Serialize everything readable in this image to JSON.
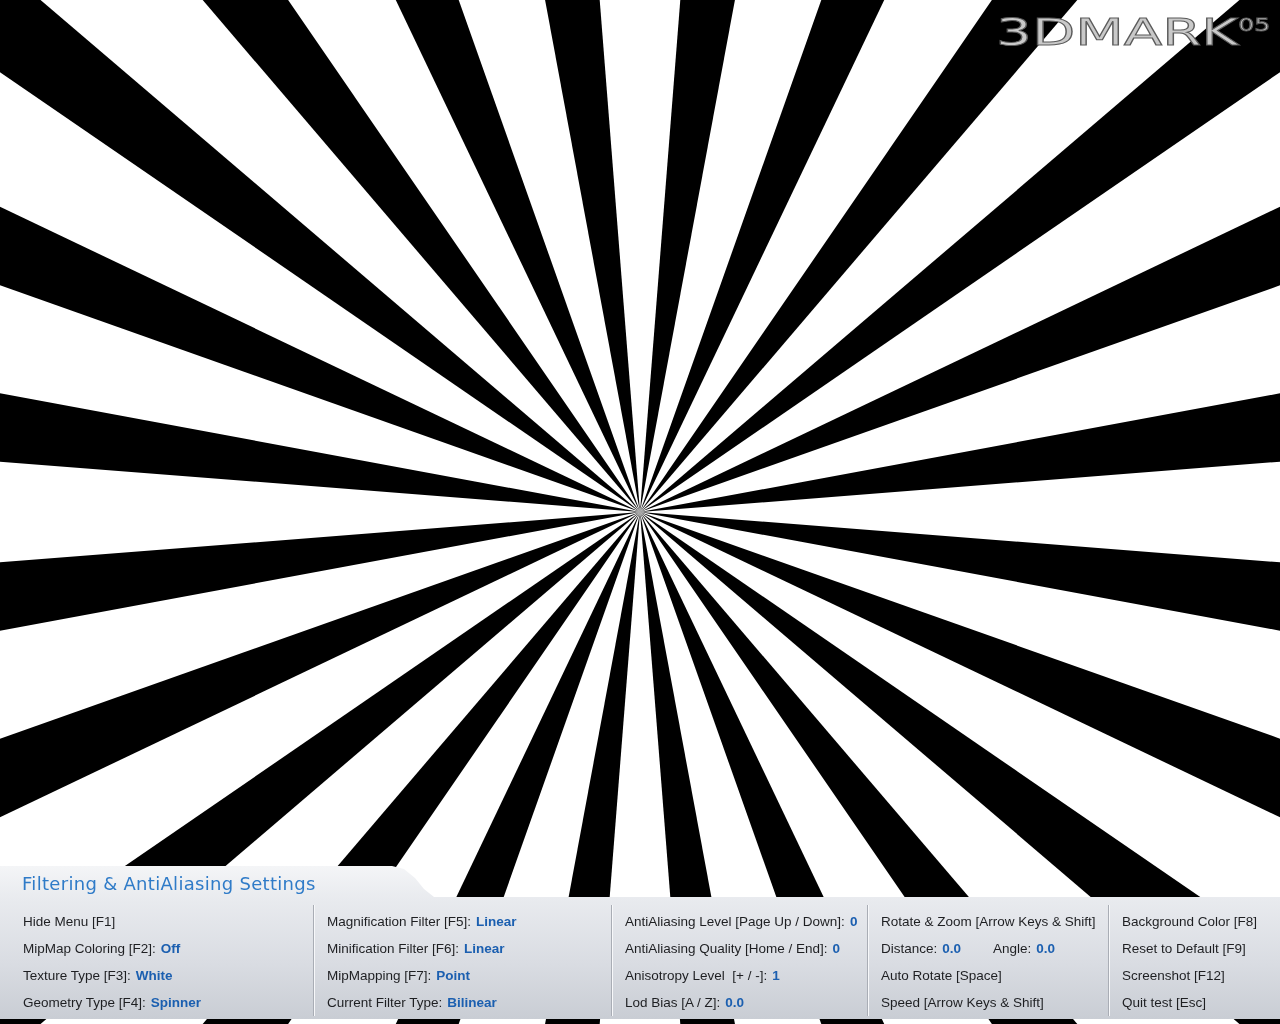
{
  "logo": {
    "name": "3DMARK",
    "edition": "05"
  },
  "panel": {
    "title": "Filtering & AntiAliasing Settings",
    "columns": [
      {
        "rows": [
          [
            {
              "label": "Hide Menu [F1]"
            }
          ],
          [
            {
              "label": "MipMap Coloring [F2]:",
              "value": "Off"
            }
          ],
          [
            {
              "label": "Texture Type [F3]:",
              "value": "White"
            }
          ],
          [
            {
              "label": "Geometry Type [F4]:",
              "value": "Spinner"
            }
          ]
        ]
      },
      {
        "rows": [
          [
            {
              "label": "Magnification Filter [F5]:",
              "value": "Linear"
            }
          ],
          [
            {
              "label": "Minification Filter [F6]:",
              "value": "Linear"
            }
          ],
          [
            {
              "label": "MipMapping [F7]:",
              "value": "Point"
            }
          ],
          [
            {
              "label": "Current Filter Type:",
              "value": "Bilinear"
            }
          ]
        ]
      },
      {
        "rows": [
          [
            {
              "label": "AntiAliasing Level [Page Up / Down]:",
              "value": "0"
            }
          ],
          [
            {
              "label": "AntiAliasing Quality [Home / End]:",
              "value": "0"
            }
          ],
          [
            {
              "label": "Anisotropy Level  [+ / -]:",
              "value": "1"
            }
          ],
          [
            {
              "label": "Lod Bias [A / Z]:",
              "value": "0.0"
            }
          ]
        ]
      },
      {
        "rows": [
          [
            {
              "label": "Rotate & Zoom [Arrow Keys & Shift]"
            }
          ],
          [
            {
              "label": "Distance:",
              "value": "0.0"
            },
            {
              "label": "Angle:",
              "value": "0.0"
            }
          ],
          [
            {
              "label": "Auto Rotate [Space]"
            }
          ],
          [
            {
              "label": "Speed [Arrow Keys & Shift]"
            }
          ]
        ]
      },
      {
        "rows": [
          [
            {
              "label": "Background Color [F8]"
            }
          ],
          [
            {
              "label": "Reset to Default [F9]"
            }
          ],
          [
            {
              "label": "Screenshot [F12]"
            }
          ],
          [
            {
              "label": "Quit test [Esc]"
            }
          ]
        ]
      }
    ]
  }
}
